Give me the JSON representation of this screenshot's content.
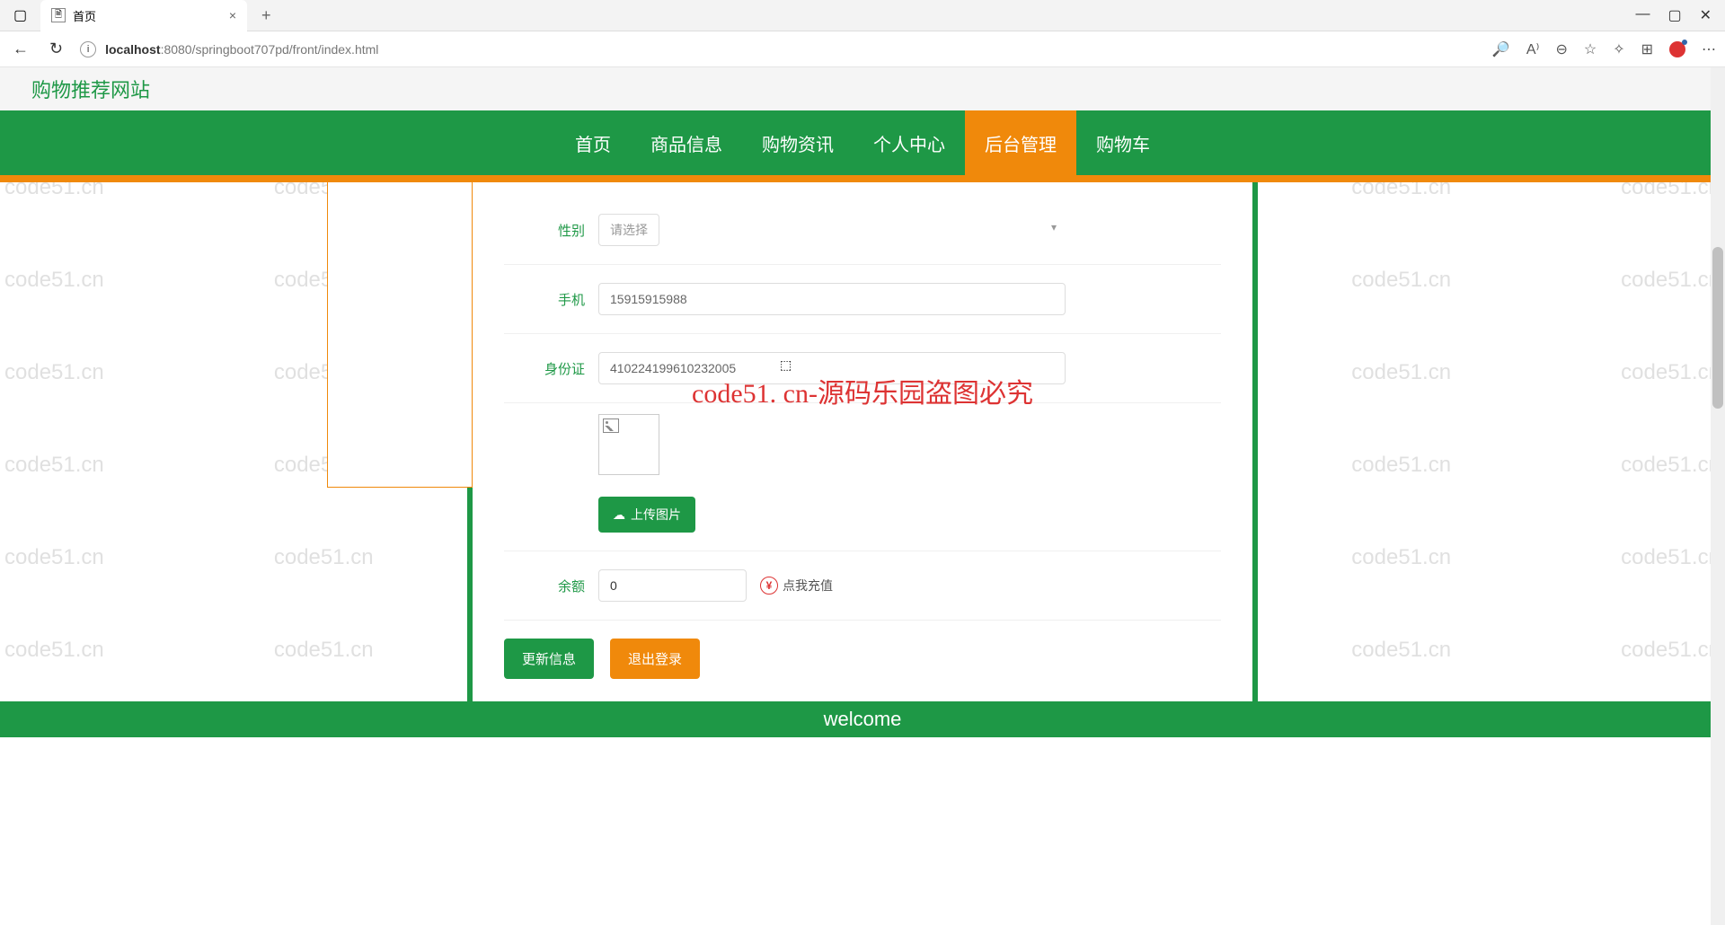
{
  "browser": {
    "tab_title": "首页",
    "url_prefix": "localhost",
    "url_rest": ":8080/springboot707pd/front/index.html"
  },
  "site": {
    "title": "购物推荐网站"
  },
  "nav": {
    "items": [
      "首页",
      "商品信息",
      "购物资讯",
      "个人中心",
      "后台管理",
      "购物车"
    ],
    "active_index": 4
  },
  "form": {
    "gender_label": "性别",
    "gender_placeholder": "请选择",
    "phone_label": "手机",
    "phone_value": "15915915988",
    "id_label": "身份证",
    "id_value": "410224199610232005",
    "upload_label": "上传图片",
    "balance_label": "余额",
    "balance_value": "0",
    "recharge_label": "点我充值",
    "update_btn": "更新信息",
    "logout_btn": "退出登录"
  },
  "footer": {
    "text": "welcome"
  },
  "watermark": {
    "text": "code51.cn",
    "big": "code51. cn-源码乐园盗图必究"
  }
}
